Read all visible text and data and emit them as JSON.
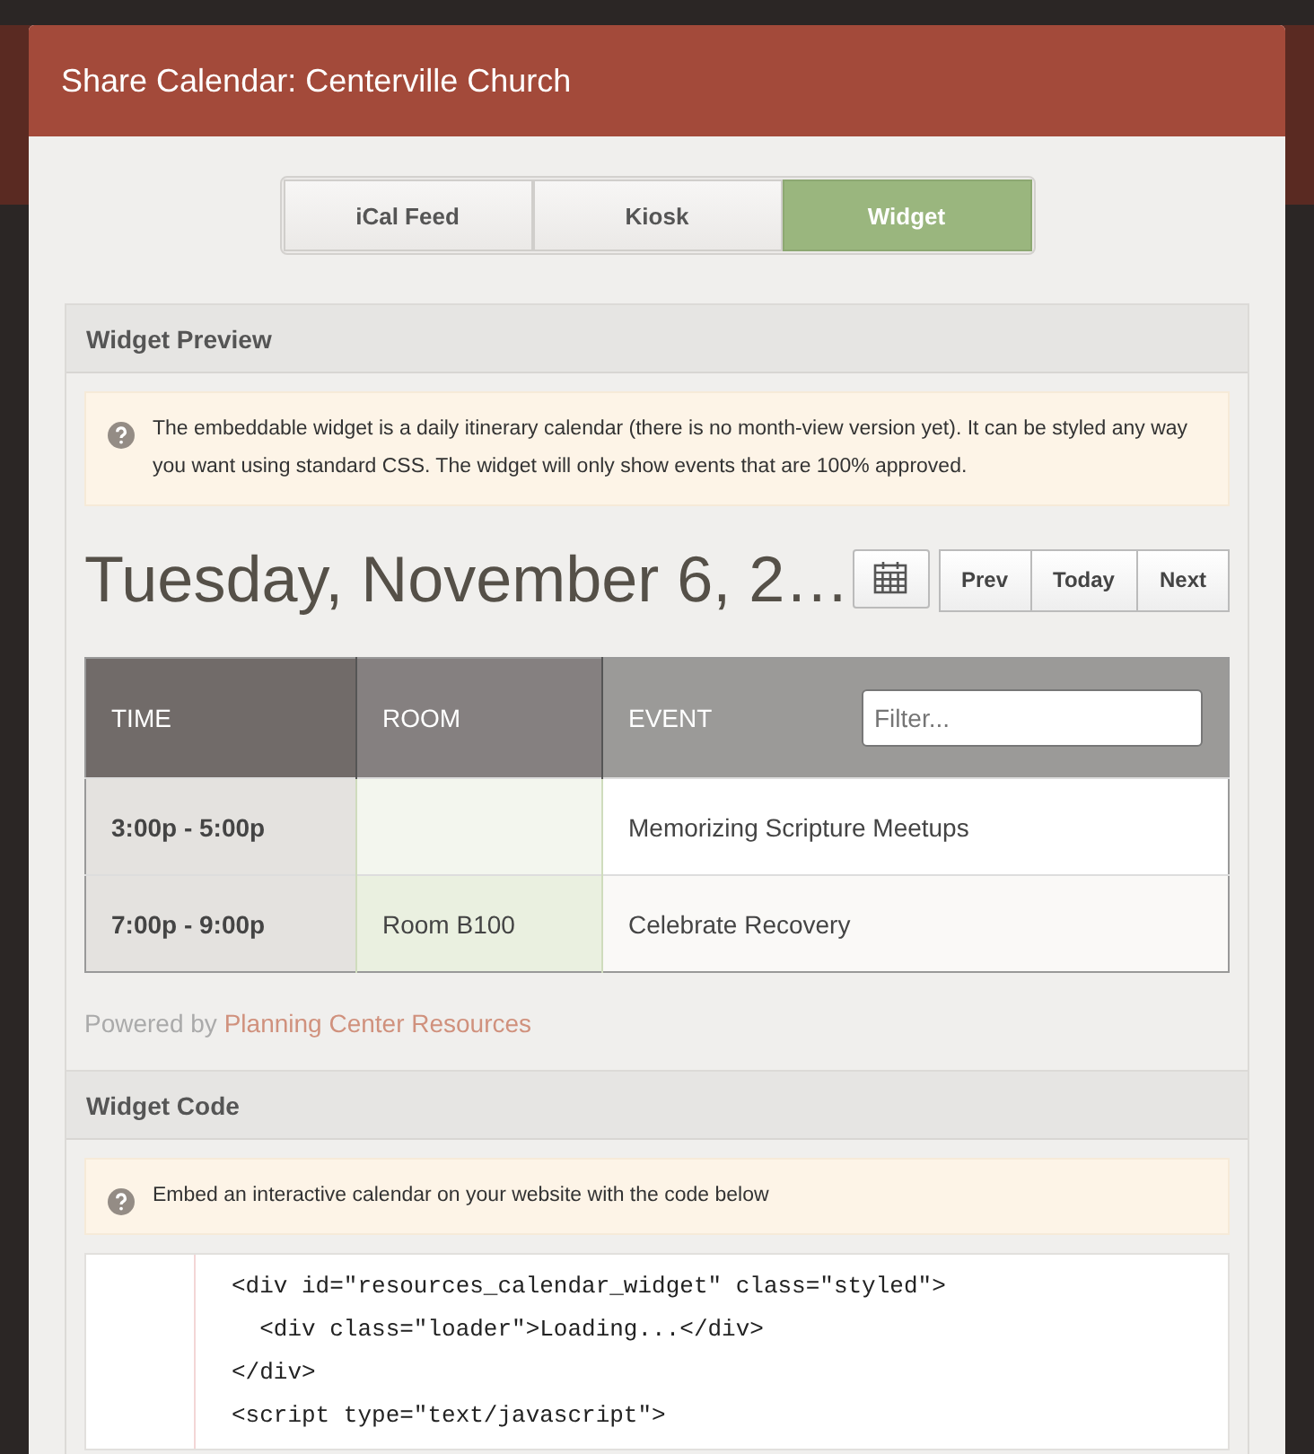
{
  "dialog": {
    "title": "Share Calendar: Centerville Church"
  },
  "tabs": [
    {
      "label": "iCal Feed",
      "selected": false
    },
    {
      "label": "Kiosk",
      "selected": false
    },
    {
      "label": "Widget",
      "selected": true
    }
  ],
  "preview": {
    "heading": "Widget Preview",
    "notice": "The embeddable widget is a daily itinerary calendar (there is no month-view version yet). It can be styled any way you want using standard CSS. The widget will only show events that are 100% approved.",
    "date": "Tuesday, November 6, 2…",
    "nav_buttons": [
      "Prev",
      "Today",
      "Next"
    ],
    "table": {
      "columns": [
        "TIME",
        "ROOM",
        "EVENT"
      ],
      "filter": {
        "placeholder": "Filter..."
      },
      "rows": [
        {
          "time": "3:00p - 5:00p",
          "room": "",
          "event": "Memorizing Scripture Meetups"
        },
        {
          "time": "7:00p - 9:00p",
          "room": "Room B100",
          "event": "Celebrate Recovery"
        }
      ]
    },
    "powered_by": "Powered by",
    "powered_link": "Planning Center Resources"
  },
  "code_section": {
    "heading": "Widget Code",
    "notice": "Embed an interactive calendar on your website with the code below",
    "lines": [
      "<div id=\"resources_calendar_widget\" class=\"styled\">",
      "  <div class=\"loader\">Loading...</div>",
      "</div>",
      "<script type=\"text/javascript\">"
    ]
  }
}
